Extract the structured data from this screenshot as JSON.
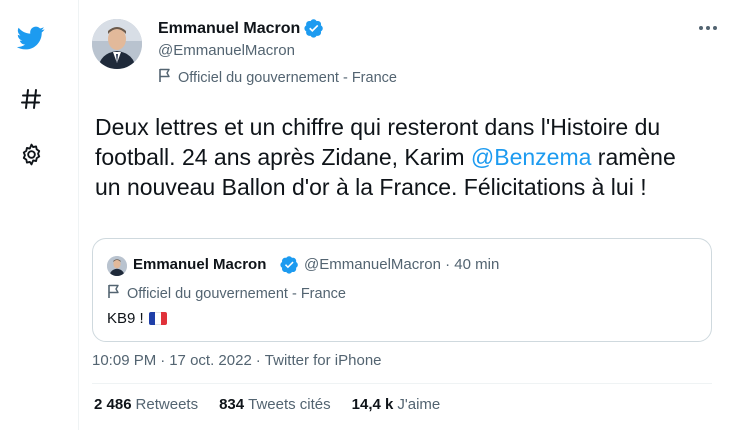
{
  "sidebar": {
    "icons": [
      "twitter-bird-icon",
      "hashtag-icon",
      "settings-gear-icon"
    ]
  },
  "tweet": {
    "author_name": "Emmanuel Macron",
    "handle": "@EmmanuelMacron",
    "label": "Officiel du gouvernement - France",
    "text_before": "Deux lettres et un chiffre qui resteront dans l'Histoire du football. 24 ans après Zidane, Karim ",
    "mention": "@Benzema",
    "text_after": " ramène un nouveau Ballon d'or à la France. Félicitations à lui !"
  },
  "quote": {
    "author_name": "Emmanuel Macron",
    "handle": "@EmmanuelMacron",
    "separator": "·",
    "time": "40 min",
    "label": "Officiel du gouvernement - France",
    "text": "KB9 !",
    "emoji": "france-flag-emoji"
  },
  "meta": {
    "time": "10:09 PM",
    "sep1": "·",
    "date": "17 oct. 2022",
    "sep2": "·",
    "source": "Twitter for iPhone"
  },
  "stats": {
    "retweets_count": "2 486",
    "retweets_label": "Retweets",
    "quotes_count": "834",
    "quotes_label": "Tweets cités",
    "likes_count": "14,4 k",
    "likes_label": "J'aime"
  },
  "colors": {
    "accent": "#1d9bf0",
    "text": "#0f1419",
    "secondary": "#536471",
    "border": "#cfd9de",
    "divider": "#eff3f4"
  }
}
